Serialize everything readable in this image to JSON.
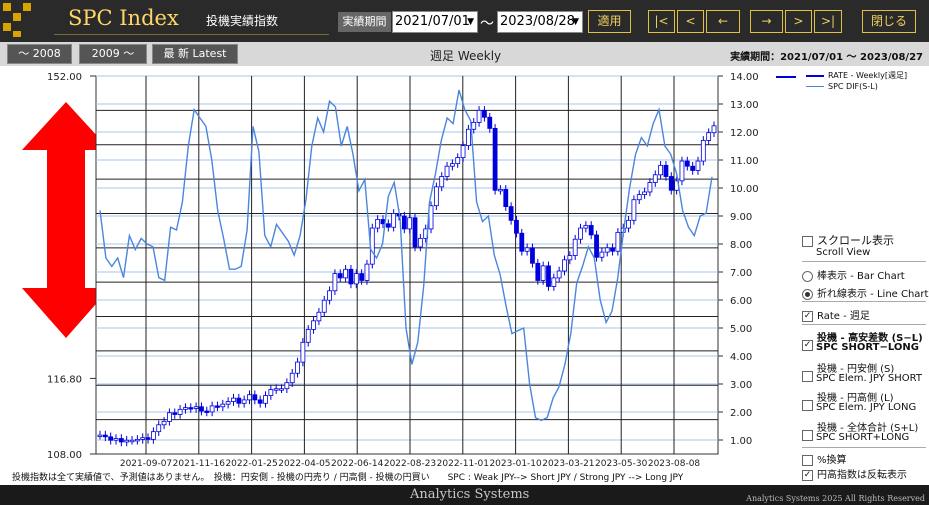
{
  "header": {
    "title": "SPC Index",
    "subtitle": "投機実績指数",
    "period_label": "実績期間",
    "start_date": "2021/07/01",
    "end_date": "2023/08/28",
    "range_sep": "～",
    "apply_label": "適用",
    "nav": [
      "|<",
      "<",
      "←",
      "→",
      ">",
      ">|"
    ],
    "close_label": "閉じる"
  },
  "toolbar": {
    "ranges": [
      "～ 2008",
      "2009 ～",
      "最 新  Latest"
    ],
    "chart_title": "週足 Weekly",
    "period_text": "実績期間：2021/07/01 ～ 2023/08/27"
  },
  "legend": {
    "rate": "RATE - Weekly[週足]",
    "spc": "SPC DIF(S-L)"
  },
  "panel": {
    "scroll_jp": "スクロール表示",
    "scroll_en": "Scroll View",
    "bar_chart": "棒表示 - Bar Chart",
    "line_chart": "折れ線表示 - Line Chart",
    "rate_weekly": "Rate - 週足",
    "spc_sl_jp": "投機 - 高安差数 (S−L)",
    "spc_sl_en": "SPC  SHORT−LONG",
    "spc_s_jp": "投機 - 円安側 (S)",
    "spc_s_en": "SPC Elem. JPY SHORT",
    "spc_l_jp": "投機 - 円高側 (L)",
    "spc_l_en": "SPC Elem. JPY LONG",
    "spc_total_jp": "投機 - 全体合計 (S+L)",
    "spc_total_en": "SPC  SHORT+LONG",
    "percent": "%換算",
    "reverse": "円高指数は反転表示",
    "check_mark": "✓"
  },
  "footnote": "投機指数は全て実績値で、予測値はありません。　投機：円安側 - 投機の円売り / 円高側 - 投機の円買い　　SPC : Weak JPY--> Short JPY / Strong JPY --> Long JPY",
  "footer": {
    "title": "Analytics Systems",
    "copyright": "Analytics Systems 2025 All Rights Reserved"
  },
  "chart_data": {
    "type": "line",
    "x_tick_labels": [
      "2021-09-07",
      "2021-11-16",
      "2022-01-25",
      "2022-04-05",
      "2022-06-14",
      "2022-08-23",
      "2022-11-01",
      "2023-01-10",
      "2023-03-21",
      "2023-05-30",
      "2023-08-08"
    ],
    "left_axis": {
      "ticks": [
        "152.00",
        "116.80",
        "108.00"
      ],
      "min": 108,
      "max": 152
    },
    "right_axis": {
      "ticks": [
        "1.00",
        "2.00",
        "3.00",
        "4.00",
        "5.00",
        "6.00",
        "7.00",
        "8.00",
        "9.00",
        "10.00",
        "11.00",
        "12.00",
        "13.00",
        "14.00"
      ],
      "min": 0.5,
      "max": 14
    },
    "series": [
      {
        "name": "RATE - Weekly[週足]",
        "axis": "left",
        "color": "#0000dd",
        "values": [
          110.2,
          110.0,
          109.6,
          109.8,
          109.4,
          109.6,
          109.6,
          109.7,
          109.9,
          109.7,
          110.6,
          111.4,
          111.8,
          112.8,
          112.6,
          113.2,
          113.4,
          113.3,
          113.5,
          113.0,
          112.9,
          113.6,
          113.5,
          113.8,
          114.1,
          114.5,
          113.9,
          114.3,
          114.9,
          114.3,
          113.9,
          114.8,
          115.5,
          115.6,
          115.6,
          116.3,
          117.4,
          118.7,
          121.0,
          122.5,
          123.5,
          124.5,
          125.9,
          127.0,
          129.0,
          128.5,
          129.5,
          127.8,
          129.0,
          128.2,
          130.1,
          134.3,
          135.3,
          134.8,
          134.4,
          136.0,
          135.7,
          134.2,
          135.5,
          132.1,
          133.1,
          134.2,
          136.9,
          139.1,
          140.3,
          141.5,
          141.8,
          142.5,
          143.9,
          145.8,
          146.6,
          148.0,
          147.2,
          145.9,
          138.7,
          138.8,
          136.8,
          135.2,
          133.7,
          131.6,
          132.0,
          130.2,
          128.2,
          129.9,
          127.5,
          128.5,
          129.3,
          130.6,
          131.1,
          133.0,
          134.3,
          134.6,
          133.5,
          130.9,
          131.5,
          132.0,
          131.6,
          133.8,
          134.3,
          135.2,
          137.6,
          138.2,
          138.5,
          139.6,
          140.5,
          141.6,
          140.3,
          138.7,
          139.8,
          142.1,
          141.5,
          141.0,
          142.1,
          144.5,
          145.4,
          146.2
        ]
      },
      {
        "name": "SPC DIF(S-L)",
        "axis": "right",
        "color": "#4a86dd",
        "values": [
          9.2,
          7.5,
          7.2,
          7.5,
          6.8,
          8.3,
          7.8,
          8.2,
          8.0,
          7.9,
          6.8,
          6.7,
          8.6,
          8.5,
          9.5,
          11.5,
          12.8,
          12.5,
          12.2,
          11.0,
          9.2,
          8.2,
          7.1,
          7.1,
          7.2,
          8.5,
          12.2,
          11.3,
          8.3,
          7.9,
          8.7,
          8.4,
          8.1,
          7.6,
          8.3,
          9.6,
          11.5,
          12.5,
          12.0,
          13.1,
          12.9,
          11.5,
          12.2,
          11.2,
          9.9,
          10.3,
          7.8,
          7.5,
          8.0,
          9.7,
          10.2,
          8.9,
          5.0,
          3.7,
          4.5,
          6.5,
          9.5,
          10.5,
          11.7,
          12.5,
          12.3,
          13.5,
          12.8,
          12.4,
          9.5,
          8.8,
          9.0,
          7.6,
          6.9,
          5.8,
          4.8,
          4.9,
          5.0,
          3.0,
          1.8,
          1.7,
          1.8,
          2.5,
          2.9,
          3.7,
          4.8,
          6.6,
          7.2,
          7.9,
          7.5,
          6.0,
          5.2,
          5.6,
          6.8,
          8.5,
          10.0,
          11.2,
          11.8,
          11.5,
          12.3,
          12.8,
          11.5,
          11.2,
          10.5,
          9.2,
          8.6,
          8.3,
          9.0,
          9.1,
          10.4
        ]
      }
    ],
    "grid": true
  }
}
